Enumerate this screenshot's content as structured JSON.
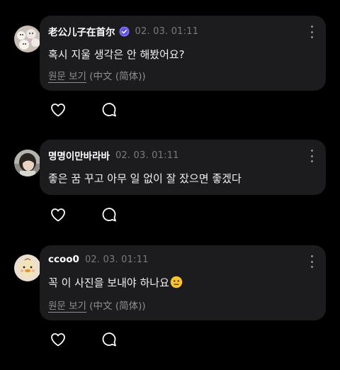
{
  "comments": [
    {
      "username": "老公儿子在首尔",
      "verified": true,
      "timestamp": "02. 03. 01:11",
      "text": "혹시 지울 생각은 안 해봤어요?",
      "translate_link": "원문 보기",
      "translate_lang": " (中文 (简体))",
      "avatar_icon": "avatar-plush-dolls"
    },
    {
      "username": "명명이만바라바",
      "verified": false,
      "timestamp": "02. 03. 01:11",
      "text": "좋은 꿈 꾸고 아무 일 없이 잘 잤으면 좋겠다",
      "avatar_icon": "avatar-person-photo"
    },
    {
      "username": "ccoo0",
      "verified": false,
      "timestamp": "02. 03. 01:11",
      "text": "꼭 이 사진을 보내야 하나요",
      "emoji": "neutral-face-emoji",
      "translate_link": "원문 보기",
      "translate_lang": " (中文 (简体))",
      "avatar_icon": "avatar-duck-plush"
    }
  ],
  "icons": {
    "like": "heart-outline-icon",
    "reply": "speech-bubble-outline-icon",
    "more": "more-vertical-icon",
    "verified": "verified-badge-icon"
  },
  "colors": {
    "background": "#000000",
    "bubble": "#1c1c1e",
    "muted_text": "#8e8e93",
    "verified_badge": "#7b6cf6"
  }
}
